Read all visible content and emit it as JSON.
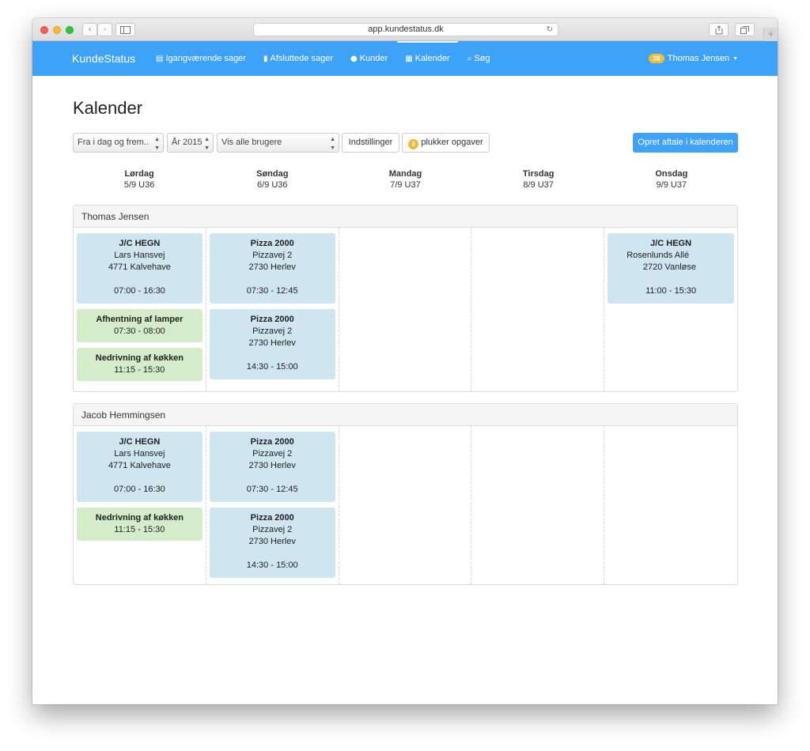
{
  "browser": {
    "url": "app.kundestatus.dk",
    "back": "‹",
    "forward": "›",
    "reload": "↻",
    "plus": "+"
  },
  "navbar": {
    "brand": "KundeStatus",
    "links": [
      {
        "icon": "▤",
        "label": "Igangværende sager"
      },
      {
        "icon": "▮",
        "label": "Afsluttede sager"
      },
      {
        "icon": "●",
        "label": "Kunder"
      },
      {
        "icon": "▦",
        "label": "Kalender"
      },
      {
        "icon": "⌕",
        "label": "Søg"
      }
    ],
    "user_badge": "38",
    "user_name": "Thomas Jensen",
    "caret": "▼"
  },
  "page": {
    "title": "Kalender"
  },
  "toolbar": {
    "range_select": "Fra i dag og frem..",
    "year_select": "År 2015",
    "users_select": "Vis alle brugere",
    "settings_button": "Indstillinger",
    "pick_count": "0",
    "pick_label": "plukker opgaver",
    "create_button": "Opret aftale i kalenderen"
  },
  "days": [
    {
      "name": "Lørdag",
      "date": "5/9 U36"
    },
    {
      "name": "Søndag",
      "date": "6/9 U36"
    },
    {
      "name": "Mandag",
      "date": "7/9 U37"
    },
    {
      "name": "Tirsdag",
      "date": "8/9 U37"
    },
    {
      "name": "Onsdag",
      "date": "9/9 U37"
    }
  ],
  "panels": [
    {
      "name": "Thomas Jensen",
      "columns": [
        [
          {
            "type": "blue",
            "title": "J/C HEGN",
            "line1": "Lars Hansvej",
            "line2": "4771 Kalvehave",
            "time": "07:00 - 16:30"
          },
          {
            "type": "green",
            "title": "Afhentning af lamper",
            "time": "07:30 - 08:00"
          },
          {
            "type": "green",
            "title": "Nedrivning af køkken",
            "time": "11:15 - 15:30"
          }
        ],
        [
          {
            "type": "blue",
            "title": "Pizza 2000",
            "line1": "Pizzavej 2",
            "line2": "2730 Herlev",
            "time": "07:30 - 12:45"
          },
          {
            "type": "blue",
            "title": "Pizza 2000",
            "line1": "Pizzavej 2",
            "line2": "2730 Herlev",
            "time": "14:30 - 15:00"
          }
        ],
        [],
        [],
        [
          {
            "type": "blue",
            "title": "J/C HEGN",
            "line1": "Rosenlunds Allé",
            "line2": "2720 Vanløse",
            "time": "11:00 - 15:30"
          }
        ]
      ]
    },
    {
      "name": "Jacob Hemmingsen",
      "columns": [
        [
          {
            "type": "blue",
            "title": "J/C HEGN",
            "line1": "Lars Hansvej",
            "line2": "4771 Kalvehave",
            "time": "07:00 - 16:30"
          },
          {
            "type": "green",
            "title": "Nedrivning af køkken",
            "time": "11:15 - 15:30"
          }
        ],
        [
          {
            "type": "blue",
            "title": "Pizza 2000",
            "line1": "Pizzavej 2",
            "line2": "2730 Herlev",
            "time": "07:30 - 12:45"
          },
          {
            "type": "blue",
            "title": "Pizza 2000",
            "line1": "Pizzavej 2",
            "line2": "2730 Herlev",
            "time": "14:30 - 15:00"
          }
        ],
        [],
        [],
        []
      ]
    }
  ]
}
